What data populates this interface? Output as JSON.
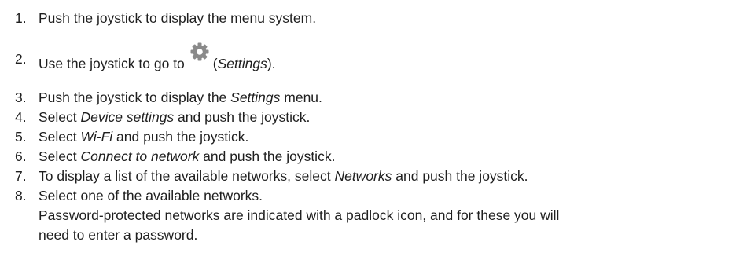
{
  "steps": [
    {
      "number": "1.",
      "parts": [
        "Push the joystick to display the menu system."
      ]
    },
    {
      "number": "2.",
      "pre": "Use the joystick to go to",
      "icon": "gear-icon",
      "mid_open": "(",
      "mid_em": "Settings",
      "mid_close": ")."
    },
    {
      "number": "3.",
      "pre": "Push the joystick to display the ",
      "em": "Settings",
      "post": " menu."
    },
    {
      "number": "4.",
      "pre": "Select ",
      "em": "Device settings",
      "post": " and push the joystick."
    },
    {
      "number": "5.",
      "pre": "Select ",
      "em": "Wi-Fi",
      "post": " and push the joystick."
    },
    {
      "number": "6.",
      "pre": "Select ",
      "em": "Connect to network",
      "post": " and push the joystick."
    },
    {
      "number": "7.",
      "pre": "To display a list of the available networks, select ",
      "em": "Networks",
      "post": " and push the joystick."
    },
    {
      "number": "8.",
      "pre": "Select one of the available networks.",
      "line2": "Password-protected networks are indicated with a padlock icon, and for these you will",
      "line3": "need to enter a password."
    }
  ],
  "colors": {
    "text": "#1f1f1f",
    "icon": "#8a8a8a"
  }
}
